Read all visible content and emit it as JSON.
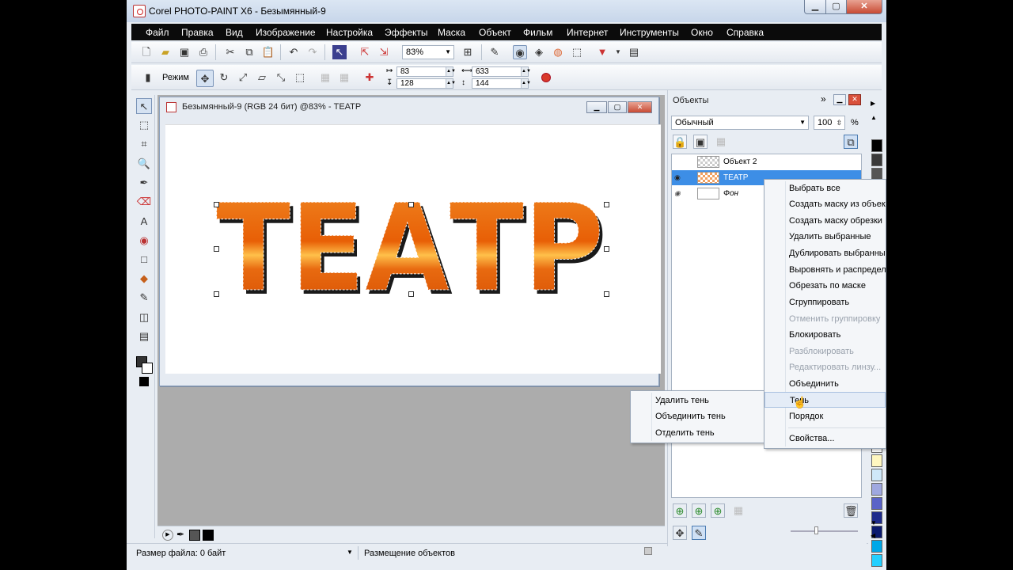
{
  "window": {
    "title": "Corel PHOTO-PAINT X6 - Безымянный-9",
    "minimize_icon": "minimize-icon",
    "maximize_icon": "maximize-icon",
    "close_icon": "close-icon"
  },
  "menu": [
    "Файл",
    "Правка",
    "Вид",
    "Изображение",
    "Настройка",
    "Эффекты",
    "Маска",
    "Объект",
    "Фильм",
    "Интернет",
    "Инструменты",
    "Окно",
    "Справка"
  ],
  "toolbar": {
    "zoom": "83%",
    "mode_label": "Режим",
    "pos_x": "83",
    "pos_y": "128",
    "width": "633",
    "height": "144"
  },
  "document": {
    "title": "Безымянный-9 (RGB 24 бит) @83% - ТЕАТР",
    "canvas_text": "ТЕАТР"
  },
  "objects_docker": {
    "title": "Объекты",
    "blend_mode": "Обычный",
    "opacity": "100",
    "opacity_unit": "%",
    "objects": [
      {
        "name": "Объект 2",
        "visible": false,
        "selected": false
      },
      {
        "name": "ТЕАТР",
        "visible": true,
        "selected": true
      },
      {
        "name": "Фон",
        "visible": true,
        "selected": false
      }
    ]
  },
  "context_menu": {
    "items": [
      {
        "label": "Выбрать все",
        "enabled": true
      },
      {
        "label": "Создать маску из объекта",
        "enabled": true
      },
      {
        "label": "Создать маску обрезки",
        "enabled": true
      },
      {
        "label": "Удалить выбранные",
        "enabled": true
      },
      {
        "label": "Дублировать выбранные",
        "enabled": true
      },
      {
        "label": "Выровнять и распределить",
        "enabled": true
      },
      {
        "label": "Обрезать по маске",
        "enabled": true
      },
      {
        "label": "Сгруппировать",
        "enabled": true
      },
      {
        "label": "Отменить группировку",
        "enabled": false
      },
      {
        "label": "Блокировать",
        "enabled": true
      },
      {
        "label": "Разблокировать",
        "enabled": false
      },
      {
        "label": "Редактировать линзу...",
        "enabled": false
      },
      {
        "label": "Объединить",
        "enabled": true
      },
      {
        "label": "Тень",
        "enabled": true,
        "highlighted": true
      },
      {
        "label": "Порядок",
        "enabled": true
      },
      {
        "label": "Свойства...",
        "enabled": true
      }
    ]
  },
  "submenu": {
    "items": [
      "Удалить тень",
      "Объединить тень",
      "Отделить тень"
    ]
  },
  "status": {
    "file_size": "Размер файла: 0 байт",
    "hint": "Размещение объектов"
  },
  "colors": {
    "accent_selection": "#3d8ee6",
    "text_fill": "#f07a10",
    "menubar": "#0b0b0b"
  },
  "palette": [
    "#000000",
    "#3a3a3a",
    "#555555",
    "#6b6b6b",
    "#8c8c8c",
    "#a8a8a8",
    "#ffffff",
    "#fff7c0",
    "#cfe8f9",
    "#9fa8e0",
    "#5a63c8",
    "#1e2b8c",
    "#0b1a6e",
    "#00a8e8",
    "#24d0ff"
  ]
}
